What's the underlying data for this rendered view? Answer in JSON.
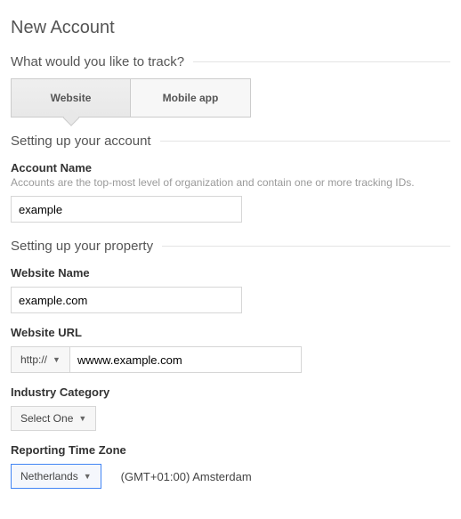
{
  "page": {
    "title": "New Account"
  },
  "track": {
    "heading": "What would you like to track?",
    "tab_website": "Website",
    "tab_mobile": "Mobile app"
  },
  "account": {
    "heading": "Setting up your account",
    "name_label": "Account Name",
    "name_help": "Accounts are the top-most level of organization and contain one or more tracking IDs.",
    "name_value": "example"
  },
  "property": {
    "heading": "Setting up your property",
    "website_name_label": "Website Name",
    "website_name_value": "example.com",
    "website_url_label": "Website URL",
    "protocol_value": "http://",
    "website_url_value": "wwww.example.com",
    "industry_label": "Industry Category",
    "industry_value": "Select One",
    "tz_label": "Reporting Time Zone",
    "tz_country": "Netherlands",
    "tz_value": "(GMT+01:00) Amsterdam"
  }
}
